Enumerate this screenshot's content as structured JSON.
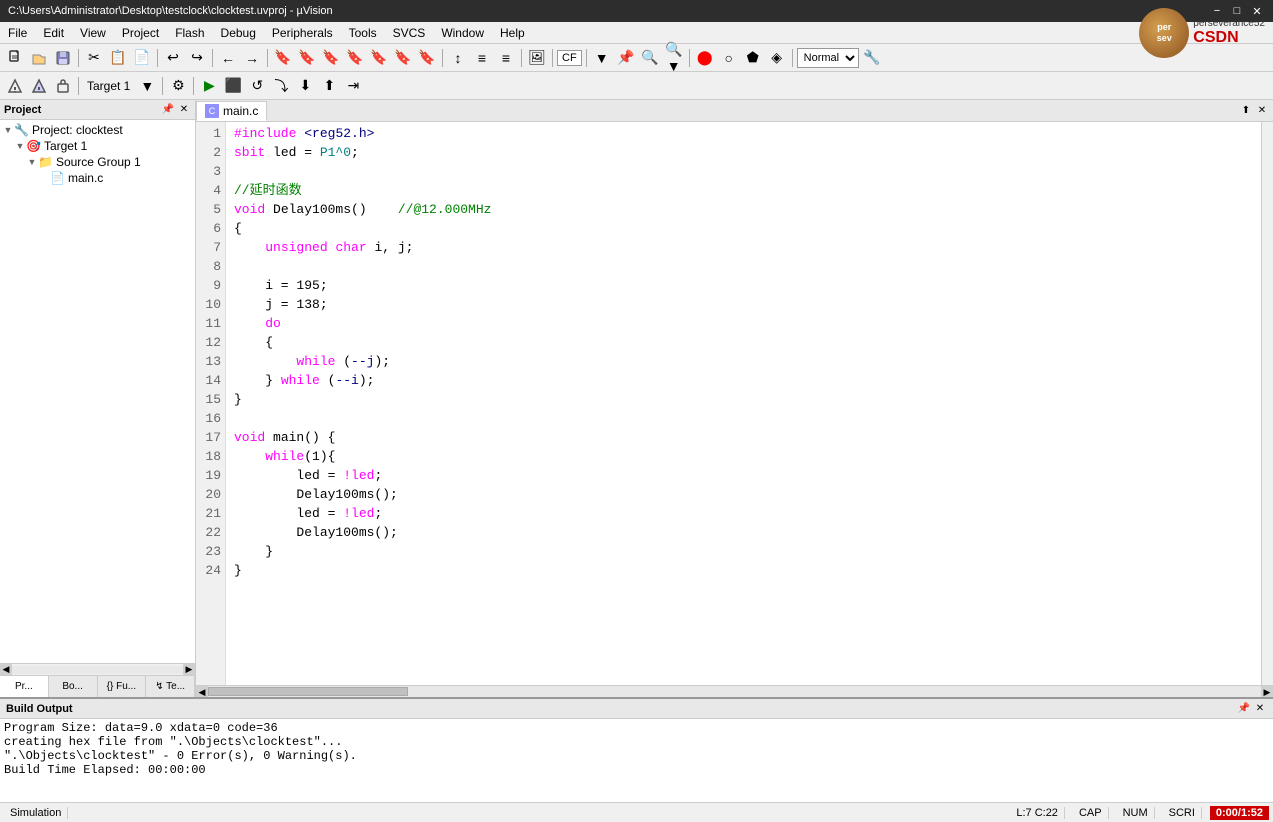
{
  "titlebar": {
    "title": "C:\\Users\\Administrator\\Desktop\\testclock\\clocktest.uvproj - µVision",
    "minimize_label": "−",
    "maximize_label": "□",
    "close_label": "✕"
  },
  "menubar": {
    "items": [
      "File",
      "Edit",
      "View",
      "Project",
      "Flash",
      "Debug",
      "Peripherals",
      "Tools",
      "SVCS",
      "Window",
      "Help"
    ]
  },
  "toolbar1": {
    "buttons": [
      "📄",
      "📂",
      "💾",
      "✂",
      "📋",
      "📄",
      "↩",
      "↪",
      "←",
      "→",
      "📌",
      "🔖",
      "🔖",
      "🔖",
      "🔗",
      "↕",
      "≡",
      "≡",
      "🖼",
      "CF"
    ]
  },
  "toolbar2": {
    "target_name": "Target 1",
    "buttons": [
      "⚙",
      "⚙",
      "⚙",
      "⚙",
      "⚙",
      "⚙",
      "⚙",
      "⚙",
      "⚙",
      "⚙",
      "⚙"
    ]
  },
  "project_panel": {
    "title": "Project",
    "pin_label": "📌",
    "close_label": "✕",
    "tree": [
      {
        "level": 0,
        "expand": "▼",
        "icon": "🔧",
        "label": "Project: clocktest"
      },
      {
        "level": 1,
        "expand": "▼",
        "icon": "🎯",
        "label": "Target 1"
      },
      {
        "level": 2,
        "expand": "▼",
        "icon": "📁",
        "label": "Source Group 1"
      },
      {
        "level": 3,
        "expand": " ",
        "icon": "📄",
        "label": "main.c"
      }
    ],
    "tabs": [
      {
        "label": "Pr...",
        "active": true
      },
      {
        "label": "Bo...",
        "active": false
      },
      {
        "label": "{} Fu...",
        "active": false
      },
      {
        "label": "↯ Te...",
        "active": false
      }
    ]
  },
  "editor": {
    "tab_label": "main.c",
    "code_lines": [
      {
        "num": 1,
        "text": "#include <reg52.h>",
        "type": "include"
      },
      {
        "num": 2,
        "text": "sbit led = P1^0;",
        "type": "sbit"
      },
      {
        "num": 3,
        "text": "",
        "type": "blank"
      },
      {
        "num": 4,
        "text": "//延时函数",
        "type": "comment"
      },
      {
        "num": 5,
        "text": "void Delay100ms()    //@12.000MHz",
        "type": "func_decl"
      },
      {
        "num": 6,
        "text": "{",
        "type": "brace"
      },
      {
        "num": 7,
        "text": "    unsigned char i, j;",
        "type": "decl"
      },
      {
        "num": 8,
        "text": "",
        "type": "blank"
      },
      {
        "num": 9,
        "text": "    i = 195;",
        "type": "assign"
      },
      {
        "num": 10,
        "text": "    j = 138;",
        "type": "assign"
      },
      {
        "num": 11,
        "text": "    do",
        "type": "keyword"
      },
      {
        "num": 12,
        "text": "    {",
        "type": "brace"
      },
      {
        "num": 13,
        "text": "        while (--j);",
        "type": "while"
      },
      {
        "num": 14,
        "text": "    } while (--i);",
        "type": "while"
      },
      {
        "num": 15,
        "text": "}",
        "type": "brace"
      },
      {
        "num": 16,
        "text": "",
        "type": "blank"
      },
      {
        "num": 17,
        "text": "void main() {",
        "type": "func_decl"
      },
      {
        "num": 18,
        "text": "    while(1){",
        "type": "while"
      },
      {
        "num": 19,
        "text": "        led = !led;",
        "type": "assign"
      },
      {
        "num": 20,
        "text": "        Delay100ms();",
        "type": "call"
      },
      {
        "num": 21,
        "text": "        led = !led;",
        "type": "assign"
      },
      {
        "num": 22,
        "text": "        Delay100ms();",
        "type": "call"
      },
      {
        "num": 23,
        "text": "    }",
        "type": "brace"
      },
      {
        "num": 24,
        "text": "}",
        "type": "brace"
      }
    ]
  },
  "build_output": {
    "title": "Build Output",
    "lines": [
      "Program Size: data=9.0 xdata=0 code=36",
      "creating hex file from \".\\Objects\\clocktest\"...",
      "\".\\Objects\\clocktest\" - 0 Error(s), 0 Warning(s).",
      "Build Time Elapsed:  00:00:00"
    ]
  },
  "statusbar": {
    "left": "Simulation",
    "position": "L:7 C:22",
    "caps": "CAP",
    "num": "NUM",
    "scrl": "SCRI",
    "time": "0:00/1:52"
  },
  "logo": {
    "user": "perseverance52",
    "brand": "CSDN"
  }
}
